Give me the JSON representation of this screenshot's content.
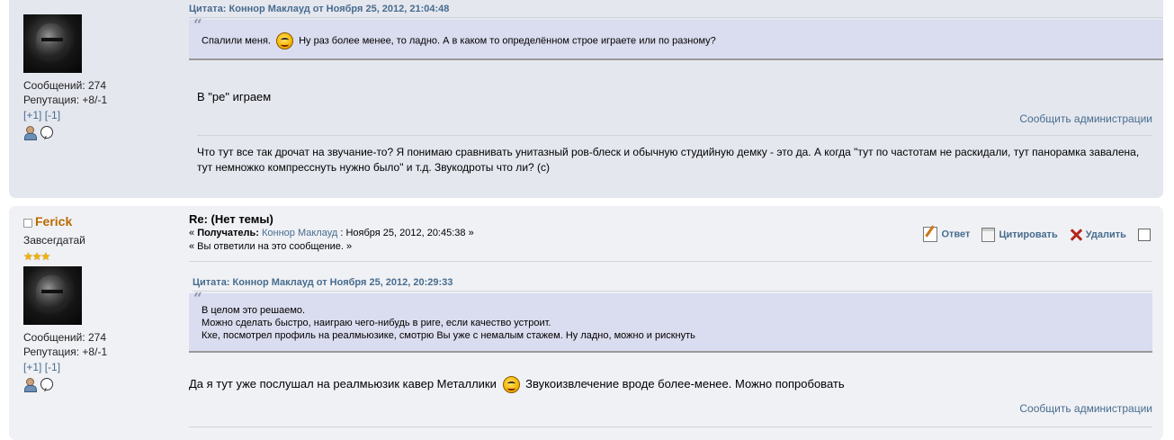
{
  "post1": {
    "poster": {
      "posts": "Сообщений: 274",
      "reputation": "Репутация: +8/-1",
      "karma_plus": "[+1]",
      "karma_minus": "[-1]"
    },
    "quote_header": "Цитата: Коннор Маклауд от Ноября 25, 2012, 21:04:48",
    "quote_text_before": "Спалили меня.",
    "quote_text_after": "Ну раз более менее, то ладно. А в каком то определённом строе играете или по разному?",
    "body": "В \"ре\" играем",
    "report": "Сообщить администрации",
    "signature": "Что тут все так дрочат на звучание-то? Я понимаю сравнивать унитазный ров-блеск и обычную студийную демку - это да. А когда \"тут по частотам не раскидали, тут панорамка завалена, тут немножко компресснуть нужно было\" и т.д. Звукодроты что ли? (с)"
  },
  "post2": {
    "poster": {
      "name": "Ferick",
      "rank": "Завсегдатай",
      "stars": "★★★",
      "posts": "Сообщений: 274",
      "reputation": "Репутация: +8/-1",
      "karma_plus": "[+1]",
      "karma_minus": "[-1]"
    },
    "subject": "Re: (Нет темы)",
    "meta_prefix": "«",
    "meta_recipient_label": "Получатель:",
    "meta_recipient": "Коннор Маклауд",
    "meta_date": ": Ноября 25, 2012, 20:45:38 »",
    "meta_replied": "« Вы ответили на это сообщение. »",
    "actions": {
      "reply": "Ответ",
      "quote": "Цитировать",
      "delete": "Удалить"
    },
    "quote_header": "Цитата: Коннор Маклауд от Ноября 25, 2012, 20:29:33",
    "quote_lines": [
      "В целом это решаемо.",
      "Можно сделать быстро, наиграю чего-нибудь в риге, если качество устроит.",
      "Кхе, посмотрел профиль на реалмьюзике, смотрю Вы уже с немалым стажем. Ну ладно, можно и рискнуть"
    ],
    "body_before": "Да я тут уже послушал на реалмьюзик кавер Металлики",
    "body_after": "Звукоизвлечение вроде более-менее. Можно попробовать",
    "report": "Сообщить администрации"
  }
}
